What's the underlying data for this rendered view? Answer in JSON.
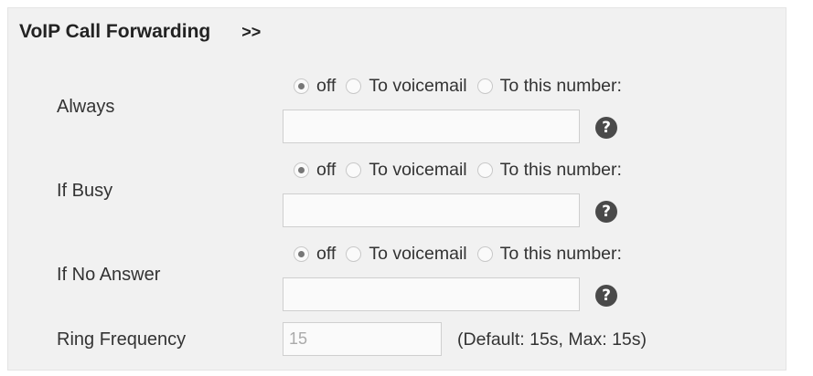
{
  "section": {
    "title": "VoIP Call Forwarding",
    "expand_label": ">>"
  },
  "options": {
    "off": "off",
    "voicemail": "To voicemail",
    "number": "To this number:"
  },
  "rows": [
    {
      "label": "Always",
      "selected": "off",
      "number_value": "",
      "help": "?"
    },
    {
      "label": "If Busy",
      "selected": "off",
      "number_value": "",
      "help": "?"
    },
    {
      "label": "If No Answer",
      "selected": "off",
      "number_value": "",
      "help": "?"
    }
  ],
  "ring_frequency": {
    "label": "Ring Frequency",
    "value": "15",
    "note": "(Default: 15s, Max: 15s)"
  }
}
